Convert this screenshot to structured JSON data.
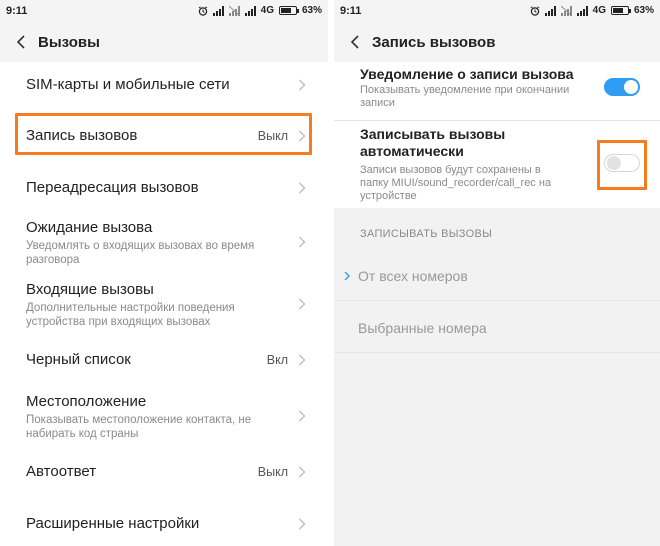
{
  "status_bar": {
    "time": "9:11",
    "network": "4G",
    "battery": "63%"
  },
  "left": {
    "title": "Вызовы",
    "items": [
      {
        "title": "SIM-карты и мобильные сети"
      },
      {
        "title": "Запись вызовов",
        "value": "Выкл"
      },
      {
        "title": "Переадресация вызовов"
      },
      {
        "title": "Ожидание вызова",
        "subtitle": "Уведомлять о входящих вызовах во время разговора"
      },
      {
        "title": "Входящие вызовы",
        "subtitle": "Дополнительные настройки поведения устройства при входящих вызовах"
      },
      {
        "title": "Черный список",
        "value": "Вкл"
      },
      {
        "title": "Местоположение",
        "subtitle": "Показывать местоположение контакта, не набирать код страны"
      },
      {
        "title": "Автоответ",
        "value": "Выкл"
      },
      {
        "title": "Расширенные настройки"
      }
    ]
  },
  "right": {
    "title": "Запись вызовов",
    "settings": [
      {
        "title": "Уведомление о записи вызова",
        "subtitle": "Показывать уведомление при окончании записи",
        "enabled": true
      },
      {
        "title": "Записывать вызовы автоматически",
        "subtitle": "Записи вызовов будут сохранены в папку MIUI/sound_recorder/call_rec на устройстве",
        "enabled": false
      }
    ],
    "section_header": "ЗАПИСЫВАТЬ ВЫЗОВЫ",
    "options": [
      {
        "label": "От всех номеров",
        "selected": true
      },
      {
        "label": "Выбранные номера",
        "selected": false
      }
    ]
  },
  "colors": {
    "accent": "#2f9df3",
    "highlight": "#f57c1f"
  }
}
